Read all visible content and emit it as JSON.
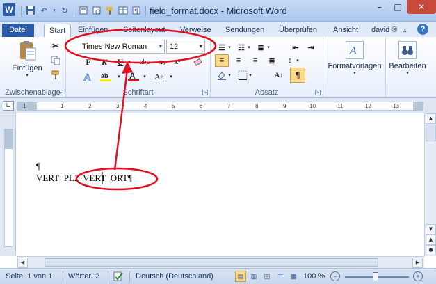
{
  "app": {
    "logo_letter": "W",
    "title": "field_format.docx - Microsoft Word"
  },
  "window_controls": {
    "minimize": "–",
    "maximize": "□",
    "close": "✕"
  },
  "tabs": [
    {
      "label": "Datei"
    },
    {
      "label": "Start"
    },
    {
      "label": "Einfügen"
    },
    {
      "label": "Seitenlayout"
    },
    {
      "label": "Verweise"
    },
    {
      "label": "Sendungen"
    },
    {
      "label": "Überprüfen"
    },
    {
      "label": "Ansicht"
    },
    {
      "label": "david ®"
    }
  ],
  "ribbon": {
    "clipboard": {
      "paste_label": "Einfügen",
      "group_label": "Zwischenablage"
    },
    "font": {
      "font_name": "Times New Roman",
      "font_size": "12",
      "bold": "F",
      "italic": "K",
      "underline": "U",
      "strike": "abc",
      "subscript": "x₂",
      "superscript": "x²",
      "change_case": "Aa",
      "group_label": "Schriftart"
    },
    "paragraph": {
      "group_label": "Absatz",
      "show_marks": "¶"
    },
    "styles": {
      "label": "Formatvorlagen"
    },
    "editing": {
      "label": "Bearbeiten"
    }
  },
  "document": {
    "line1": "¶",
    "line2": "VERT_PLZ·VERT_ORT¶"
  },
  "status": {
    "page": "Seite: 1 von 1",
    "words": "Wörter: 2",
    "language": "Deutsch (Deutschland)",
    "zoom": "100 %",
    "zoom_level": 1.0
  },
  "colors": {
    "accent": "#2b5aa8",
    "annotation": "#e01020",
    "highlight": "#ffd98a"
  }
}
